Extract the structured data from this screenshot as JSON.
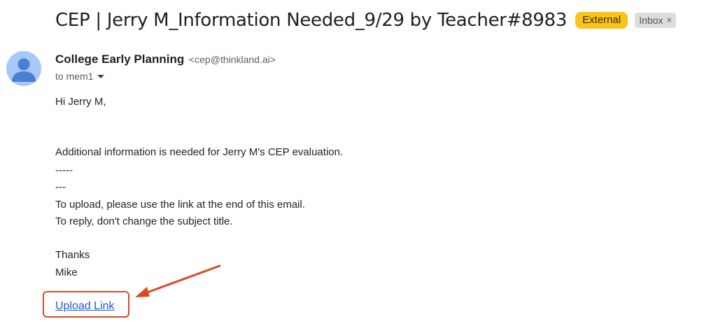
{
  "email": {
    "subject": "CEP | Jerry M_Information Needed_9/29 by Teacher#8983",
    "labels": {
      "external": "External",
      "inbox": "Inbox",
      "inbox_remove": "×"
    },
    "sender": {
      "name": "College Early Planning",
      "email": "<cep@thinkland.ai>"
    },
    "recipient": "to mem1",
    "body": {
      "greeting": "Hi Jerry M,",
      "line1": "Additional information is needed for Jerry M's CEP evaluation.",
      "line2": "-----",
      "line3": "---",
      "line4": "To upload, please use the link at the end of this email.",
      "line5": "To reply, don't change the subject title.",
      "thanks": "Thanks",
      "signature": "Mike"
    },
    "link_text": "Upload Link"
  },
  "colors": {
    "external_badge": "#f9c51b",
    "annotation": "#d84a25",
    "link": "#1a5cd6",
    "avatar_bg": "#a8c7fa",
    "avatar_fg": "#4a7fd6"
  },
  "icons": {
    "avatar": "person-icon",
    "details": "caret-down-icon",
    "annotation": "arrow-icon"
  }
}
